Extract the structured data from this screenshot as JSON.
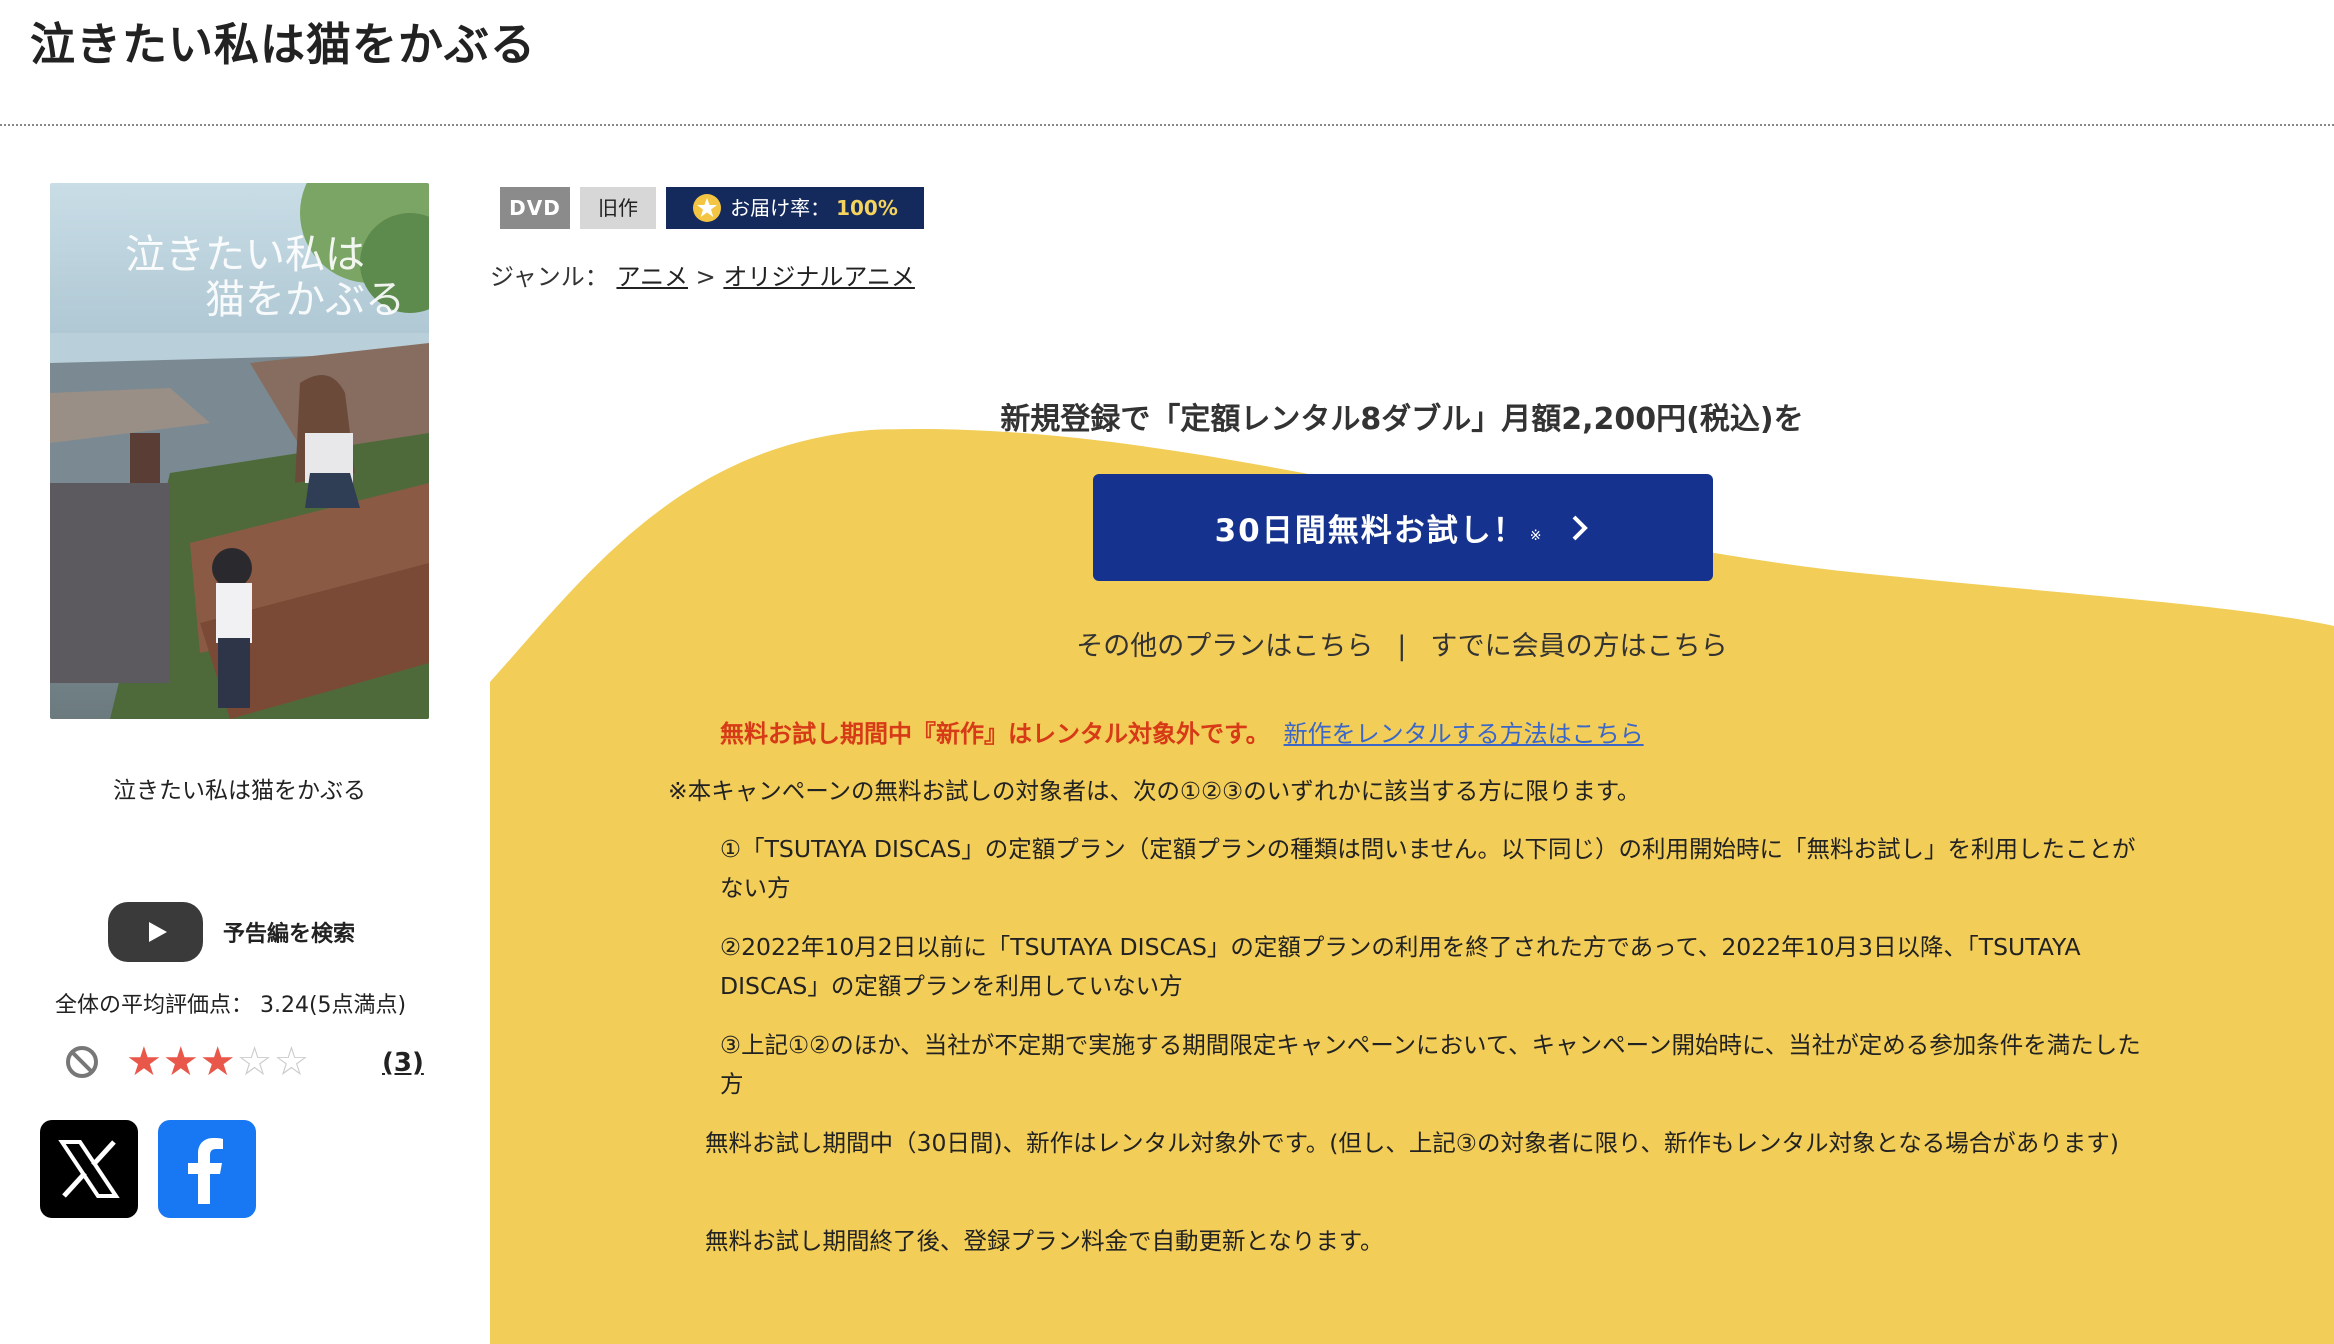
{
  "page": {
    "title": "泣きたい私は猫をかぶる"
  },
  "item": {
    "title": "泣きたい私は猫をかぶる",
    "poster_alt": "泣きたい私は猫をかぶる",
    "trailer_label": "予告編を検索",
    "avg_rating_text": "全体の平均評価点： 3.24(5点満点)",
    "rating_value": 3.24,
    "review_count": "(3)"
  },
  "badges": {
    "format": "DVD",
    "release": "旧作",
    "delivery_label": "お届け率：",
    "delivery_rate": "100%"
  },
  "genre": {
    "label": "ジャンル：",
    "items": [
      "アニメ",
      "オリジナルアニメ"
    ],
    "separator": ">"
  },
  "campaign": {
    "headline": "新規登録で「定額レンタル8ダブル」月額2,200円(税込)を",
    "trial_button": "30日間無料お試し！",
    "trial_mark": "※",
    "other_plans": "その他のプランはこちら",
    "divider": "|",
    "member_link": "すでに会員の方はこちら",
    "notice": "無料お試し期間中『新作』はレンタル対象外です。",
    "notice_link": "新作をレンタルする方法はこちら",
    "terms_intro": "※本キャンペーンの無料お試しの対象者は、次の①②③のいずれかに該当する方に限ります。",
    "terms_1": "①「TSUTAYA DISCAS」の定額プラン（定額プランの種類は問いません。以下同じ）の利用開始時に「無料お試し」を利用したことがない方",
    "terms_2": "②2022年10月2日以前に「TSUTAYA DISCAS」の定額プランの利用を終了された方であって、2022年10月3日以降、「TSUTAYA DISCAS」の定額プランを利用していない方",
    "terms_3": "③上記①②のほか、当社が不定期で実施する期間限定キャンペーンにおいて、キャンペーン開始時に、当社が定める参加条件を満たした方",
    "terms_4": "無料お試し期間中（30日間)、新作はレンタル対象外です。(但し、上記③の対象者に限り、新作もレンタル対象となる場合があります)",
    "terms_5": "無料お試し期間終了後、登録プラン料金で自動更新となります。"
  },
  "colors": {
    "campaign_bg": "#f2cd57",
    "trial_button": "#15338e",
    "delivery_badge": "#142a5c",
    "notice_red": "#d63a16",
    "link_blue": "#3b67c9",
    "star": "#e8574a",
    "facebook": "#1877f2"
  },
  "icons": {
    "trailer": "youtube-play-icon",
    "no_rating": "prohibited-icon",
    "x_share": "x-logo-icon",
    "facebook_share": "facebook-logo-icon",
    "delivery": "star-medal-icon",
    "trial_chevron": "chevron-right-icon"
  }
}
